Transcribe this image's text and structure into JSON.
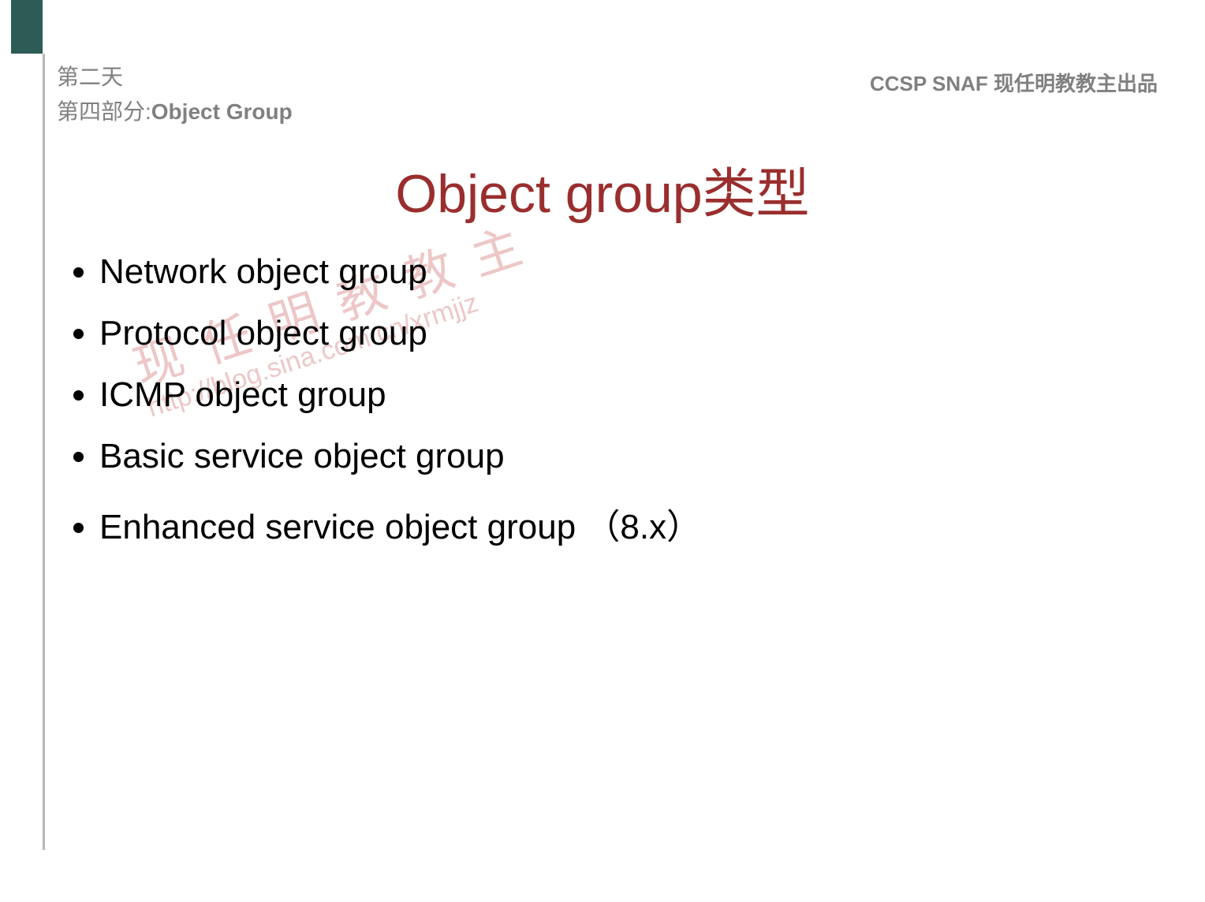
{
  "header": {
    "day": "第二天",
    "section_prefix": "第四部分:",
    "section_name": "Object Group",
    "right_label": "CCSP SNAF  现任明教教主出品"
  },
  "title": "Object group类型",
  "bullets": [
    "Network object group",
    "Protocol object group",
    "ICMP object group",
    "Basic service object group",
    "Enhanced service object group （8.x）"
  ],
  "watermark": {
    "text_cn": "现任明教教主",
    "url": "http://blog.sina.com.cn/xrmjjz"
  }
}
